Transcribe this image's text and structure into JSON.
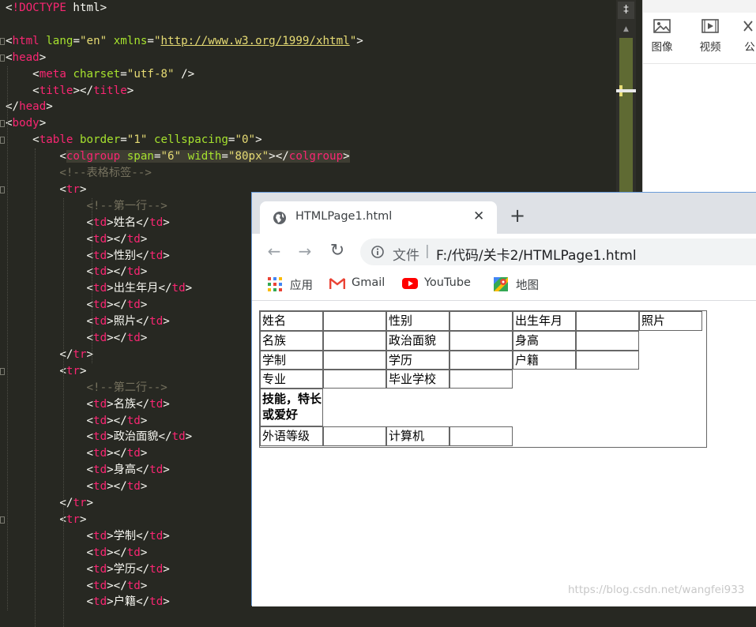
{
  "editor": {
    "lines": [
      [
        [
          "tk-punct",
          "<"
        ],
        [
          "tk-tag",
          "!DOCTYPE"
        ],
        [
          "tk-punct",
          " html>"
        ]
      ],
      [],
      [
        [
          "tk-punct",
          "<"
        ],
        [
          "tk-tag",
          "html"
        ],
        [
          "tk-punct",
          " "
        ],
        [
          "tk-attr",
          "lang"
        ],
        [
          "tk-punct",
          "="
        ],
        [
          "tk-str",
          "\"en\""
        ],
        [
          "tk-punct",
          " "
        ],
        [
          "tk-attr",
          "xmlns"
        ],
        [
          "tk-punct",
          "="
        ],
        [
          "tk-str",
          "\""
        ],
        [
          "tk-url",
          "http://www.w3.org/1999/xhtml"
        ],
        [
          "tk-str",
          "\""
        ],
        [
          "tk-punct",
          ">"
        ]
      ],
      [
        [
          "tk-punct",
          "<"
        ],
        [
          "tk-tag",
          "head"
        ],
        [
          "tk-punct",
          ">"
        ]
      ],
      [
        [
          "tk-punct",
          "    <"
        ],
        [
          "tk-tag",
          "meta"
        ],
        [
          "tk-punct",
          " "
        ],
        [
          "tk-attr",
          "charset"
        ],
        [
          "tk-punct",
          "="
        ],
        [
          "tk-str",
          "\"utf-8\""
        ],
        [
          "tk-punct",
          " />"
        ]
      ],
      [
        [
          "tk-punct",
          "    <"
        ],
        [
          "tk-tag",
          "title"
        ],
        [
          "tk-punct",
          "></"
        ],
        [
          "tk-tag",
          "title"
        ],
        [
          "tk-punct",
          ">"
        ]
      ],
      [
        [
          "tk-punct",
          "</"
        ],
        [
          "tk-tag",
          "head"
        ],
        [
          "tk-punct",
          ">"
        ]
      ],
      [
        [
          "tk-punct",
          "<"
        ],
        [
          "tk-tag",
          "body"
        ],
        [
          "tk-punct",
          ">"
        ]
      ],
      [
        [
          "tk-punct",
          "    <"
        ],
        [
          "tk-tag",
          "table"
        ],
        [
          "tk-punct",
          " "
        ],
        [
          "tk-attr",
          "border"
        ],
        [
          "tk-punct",
          "="
        ],
        [
          "tk-str",
          "\"1\""
        ],
        [
          "tk-punct",
          " "
        ],
        [
          "tk-attr",
          "cellspacing"
        ],
        [
          "tk-punct",
          "="
        ],
        [
          "tk-str",
          "\"0\""
        ],
        [
          "tk-punct",
          ">"
        ]
      ],
      [
        [
          "tk-punct",
          "        <"
        ],
        [
          "tk-tag hl",
          "colgroup"
        ],
        [
          "tk-punct hl",
          " "
        ],
        [
          "tk-attr hl",
          "span"
        ],
        [
          "tk-punct hl",
          "="
        ],
        [
          "tk-str hl",
          "\"6\""
        ],
        [
          "tk-punct hl",
          " "
        ],
        [
          "tk-attr hl",
          "width"
        ],
        [
          "tk-punct hl",
          "="
        ],
        [
          "tk-str hl",
          "\"80px\""
        ],
        [
          "tk-punct hl",
          "></"
        ],
        [
          "tk-tag hl",
          "colgroup"
        ],
        [
          "tk-punct hl",
          ">"
        ]
      ],
      [
        [
          "tk-comment",
          "        <!--表格标签-->"
        ]
      ],
      [
        [
          "tk-punct",
          "        <"
        ],
        [
          "tk-tag",
          "tr"
        ],
        [
          "tk-punct",
          ">"
        ]
      ],
      [
        [
          "tk-comment",
          "            <!--第一行-->"
        ]
      ],
      [
        [
          "tk-punct",
          "            <"
        ],
        [
          "tk-tag",
          "td"
        ],
        [
          "tk-punct",
          ">"
        ],
        [
          "tk-text",
          "姓名"
        ],
        [
          "tk-punct",
          "</"
        ],
        [
          "tk-tag",
          "td"
        ],
        [
          "tk-punct",
          ">"
        ]
      ],
      [
        [
          "tk-punct",
          "            <"
        ],
        [
          "tk-tag",
          "td"
        ],
        [
          "tk-punct",
          "></"
        ],
        [
          "tk-tag",
          "td"
        ],
        [
          "tk-punct",
          ">"
        ]
      ],
      [
        [
          "tk-punct",
          "            <"
        ],
        [
          "tk-tag",
          "td"
        ],
        [
          "tk-punct",
          ">"
        ],
        [
          "tk-text",
          "性别"
        ],
        [
          "tk-punct",
          "</"
        ],
        [
          "tk-tag",
          "td"
        ],
        [
          "tk-punct",
          ">"
        ]
      ],
      [
        [
          "tk-punct",
          "            <"
        ],
        [
          "tk-tag",
          "td"
        ],
        [
          "tk-punct",
          "></"
        ],
        [
          "tk-tag",
          "td"
        ],
        [
          "tk-punct",
          ">"
        ]
      ],
      [
        [
          "tk-punct",
          "            <"
        ],
        [
          "tk-tag",
          "td"
        ],
        [
          "tk-punct",
          ">"
        ],
        [
          "tk-text",
          "出生年月"
        ],
        [
          "tk-punct",
          "</"
        ],
        [
          "tk-tag",
          "td"
        ],
        [
          "tk-punct",
          ">"
        ]
      ],
      [
        [
          "tk-punct",
          "            <"
        ],
        [
          "tk-tag",
          "td"
        ],
        [
          "tk-punct",
          "></"
        ],
        [
          "tk-tag",
          "td"
        ],
        [
          "tk-punct",
          ">"
        ]
      ],
      [
        [
          "tk-punct",
          "            <"
        ],
        [
          "tk-tag",
          "td"
        ],
        [
          "tk-punct",
          ">"
        ],
        [
          "tk-text",
          "照片"
        ],
        [
          "tk-punct",
          "</"
        ],
        [
          "tk-tag",
          "td"
        ],
        [
          "tk-punct",
          ">"
        ]
      ],
      [
        [
          "tk-punct",
          "            <"
        ],
        [
          "tk-tag",
          "td"
        ],
        [
          "tk-punct",
          "></"
        ],
        [
          "tk-tag",
          "td"
        ],
        [
          "tk-punct",
          ">"
        ]
      ],
      [
        [
          "tk-punct",
          "        </"
        ],
        [
          "tk-tag",
          "tr"
        ],
        [
          "tk-punct",
          ">"
        ]
      ],
      [
        [
          "tk-punct",
          "        <"
        ],
        [
          "tk-tag",
          "tr"
        ],
        [
          "tk-punct",
          ">"
        ]
      ],
      [
        [
          "tk-comment",
          "            <!--第二行-->"
        ]
      ],
      [
        [
          "tk-punct",
          "            <"
        ],
        [
          "tk-tag",
          "td"
        ],
        [
          "tk-punct",
          ">"
        ],
        [
          "tk-text",
          "名族"
        ],
        [
          "tk-punct",
          "</"
        ],
        [
          "tk-tag",
          "td"
        ],
        [
          "tk-punct",
          ">"
        ]
      ],
      [
        [
          "tk-punct",
          "            <"
        ],
        [
          "tk-tag",
          "td"
        ],
        [
          "tk-punct",
          "></"
        ],
        [
          "tk-tag",
          "td"
        ],
        [
          "tk-punct",
          ">"
        ]
      ],
      [
        [
          "tk-punct",
          "            <"
        ],
        [
          "tk-tag",
          "td"
        ],
        [
          "tk-punct",
          ">"
        ],
        [
          "tk-text",
          "政治面貌"
        ],
        [
          "tk-punct",
          "</"
        ],
        [
          "tk-tag",
          "td"
        ],
        [
          "tk-punct",
          ">"
        ]
      ],
      [
        [
          "tk-punct",
          "            <"
        ],
        [
          "tk-tag",
          "td"
        ],
        [
          "tk-punct",
          "></"
        ],
        [
          "tk-tag",
          "td"
        ],
        [
          "tk-punct",
          ">"
        ]
      ],
      [
        [
          "tk-punct",
          "            <"
        ],
        [
          "tk-tag",
          "td"
        ],
        [
          "tk-punct",
          ">"
        ],
        [
          "tk-text",
          "身高"
        ],
        [
          "tk-punct",
          "</"
        ],
        [
          "tk-tag",
          "td"
        ],
        [
          "tk-punct",
          ">"
        ]
      ],
      [
        [
          "tk-punct",
          "            <"
        ],
        [
          "tk-tag",
          "td"
        ],
        [
          "tk-punct",
          "></"
        ],
        [
          "tk-tag",
          "td"
        ],
        [
          "tk-punct",
          ">"
        ]
      ],
      [
        [
          "tk-punct",
          "        </"
        ],
        [
          "tk-tag",
          "tr"
        ],
        [
          "tk-punct",
          ">"
        ]
      ],
      [
        [
          "tk-punct",
          "        <"
        ],
        [
          "tk-tag",
          "tr"
        ],
        [
          "tk-punct",
          ">"
        ]
      ],
      [
        [
          "tk-punct",
          "            <"
        ],
        [
          "tk-tag",
          "td"
        ],
        [
          "tk-punct",
          ">"
        ],
        [
          "tk-text",
          "学制"
        ],
        [
          "tk-punct",
          "</"
        ],
        [
          "tk-tag",
          "td"
        ],
        [
          "tk-punct",
          ">"
        ]
      ],
      [
        [
          "tk-punct",
          "            <"
        ],
        [
          "tk-tag",
          "td"
        ],
        [
          "tk-punct",
          "></"
        ],
        [
          "tk-tag",
          "td"
        ],
        [
          "tk-punct",
          ">"
        ]
      ],
      [
        [
          "tk-punct",
          "            <"
        ],
        [
          "tk-tag",
          "td"
        ],
        [
          "tk-punct",
          ">"
        ],
        [
          "tk-text",
          "学历"
        ],
        [
          "tk-punct",
          "</"
        ],
        [
          "tk-tag",
          "td"
        ],
        [
          "tk-punct",
          ">"
        ]
      ],
      [
        [
          "tk-punct",
          "            <"
        ],
        [
          "tk-tag",
          "td"
        ],
        [
          "tk-punct",
          "></"
        ],
        [
          "tk-tag",
          "td"
        ],
        [
          "tk-punct",
          ">"
        ]
      ],
      [
        [
          "tk-punct",
          "            <"
        ],
        [
          "tk-tag",
          "td"
        ],
        [
          "tk-punct",
          ">"
        ],
        [
          "tk-text",
          "户籍"
        ],
        [
          "tk-punct",
          "</"
        ],
        [
          "tk-tag",
          "td"
        ],
        [
          "tk-punct",
          ">"
        ]
      ]
    ]
  },
  "ribbon": {
    "items": [
      {
        "label": "图像",
        "icon": "image-icon"
      },
      {
        "label": "视频",
        "icon": "video-icon"
      },
      {
        "label": "公",
        "icon": "formula-icon"
      }
    ]
  },
  "scrollbar": {
    "split_glyph": "‡"
  },
  "browser": {
    "tab_title": "HTMLPage1.html",
    "close_glyph": "✕",
    "new_tab_glyph": "+",
    "nav": {
      "back": "←",
      "forward": "→",
      "reload": "↻"
    },
    "url_prefix": "文件",
    "url_separator": "|",
    "url": "F:/代码/关卡2/HTMLPage1.html",
    "bookmarks": [
      {
        "label": "应用",
        "icon": "apps-grid-icon"
      },
      {
        "label": "Gmail",
        "icon": "gmail-icon"
      },
      {
        "label": "YouTube",
        "icon": "youtube-icon"
      },
      {
        "label": "地图",
        "icon": "maps-icon"
      }
    ]
  },
  "table": {
    "rows": [
      [
        "姓名",
        "",
        "性别",
        "",
        "出生年月",
        "",
        "照片"
      ],
      [
        "名族",
        "",
        "政治面貌",
        "",
        "身高",
        ""
      ],
      [
        "学制",
        "",
        "学历",
        "",
        "户籍",
        ""
      ],
      [
        "专业",
        "",
        "毕业学校",
        ""
      ],
      [
        "技能，特长或爱好"
      ],
      [
        "外语等级",
        "",
        "计算机",
        ""
      ]
    ]
  },
  "watermark": "https://blog.csdn.net/wangfei933"
}
